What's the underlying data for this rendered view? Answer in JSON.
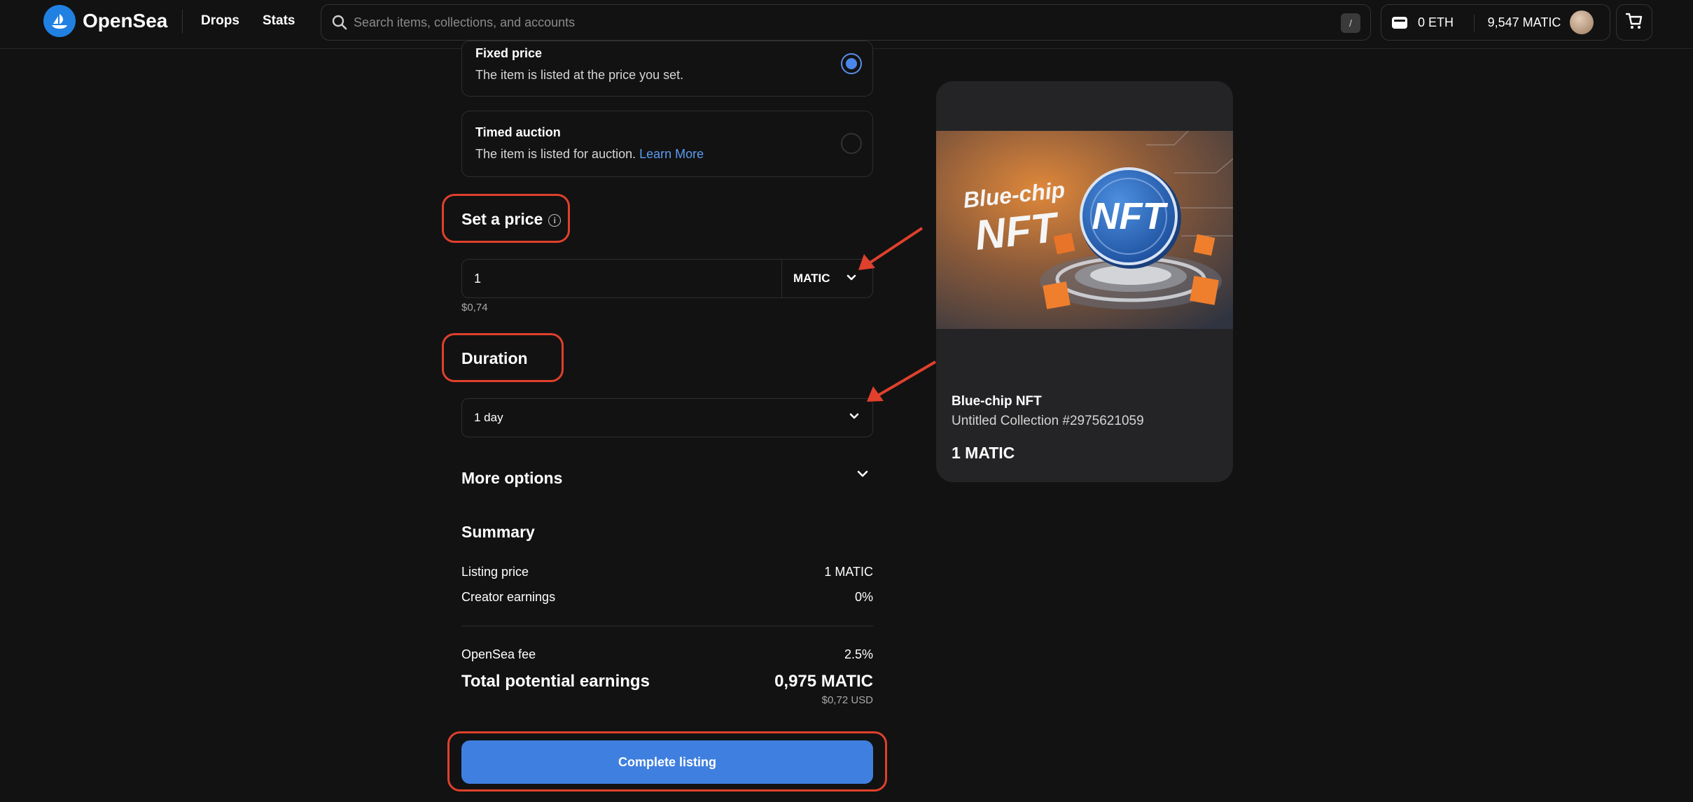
{
  "header": {
    "brand": "OpenSea",
    "nav": [
      "Drops",
      "Stats"
    ],
    "search_placeholder": "Search items, collections, and accounts",
    "search_shortcut": "/",
    "wallet_eth": "0 ETH",
    "wallet_matic": "9,547 MATIC"
  },
  "listing_type": {
    "fixed": {
      "title": "Fixed price",
      "desc": "The item is listed at the price you set.",
      "selected": true
    },
    "auction": {
      "title": "Timed auction",
      "desc": "The item is listed for auction.",
      "learn_more": "Learn More",
      "selected": false
    }
  },
  "price": {
    "title": "Set a price",
    "info_glyph": "i",
    "value": "1",
    "currency": "MATIC",
    "usd": "$0,74"
  },
  "duration": {
    "title": "Duration",
    "value": "1 day"
  },
  "more_options": "More options",
  "summary": {
    "title": "Summary",
    "listing_price_label": "Listing price",
    "listing_price_value": "1 MATIC",
    "creator_earnings_label": "Creator earnings",
    "creator_earnings_value": "0%",
    "fee_label": "OpenSea fee",
    "fee_value": "2.5%",
    "total_label": "Total potential earnings",
    "total_value": "0,975 MATIC",
    "total_usd": "$0,72 USD"
  },
  "complete_button": "Complete listing",
  "preview": {
    "image_text_line1": "Blue-chip",
    "image_text_line2": "NFT",
    "coin_text": "NFT",
    "name": "Blue-chip NFT",
    "collection": "Untitled Collection #2975621059",
    "price": "1 MATIC"
  },
  "colors": {
    "background": "#121212",
    "accent": "#3f7fe0",
    "annotation": "#e0402c",
    "card": "#242426"
  }
}
